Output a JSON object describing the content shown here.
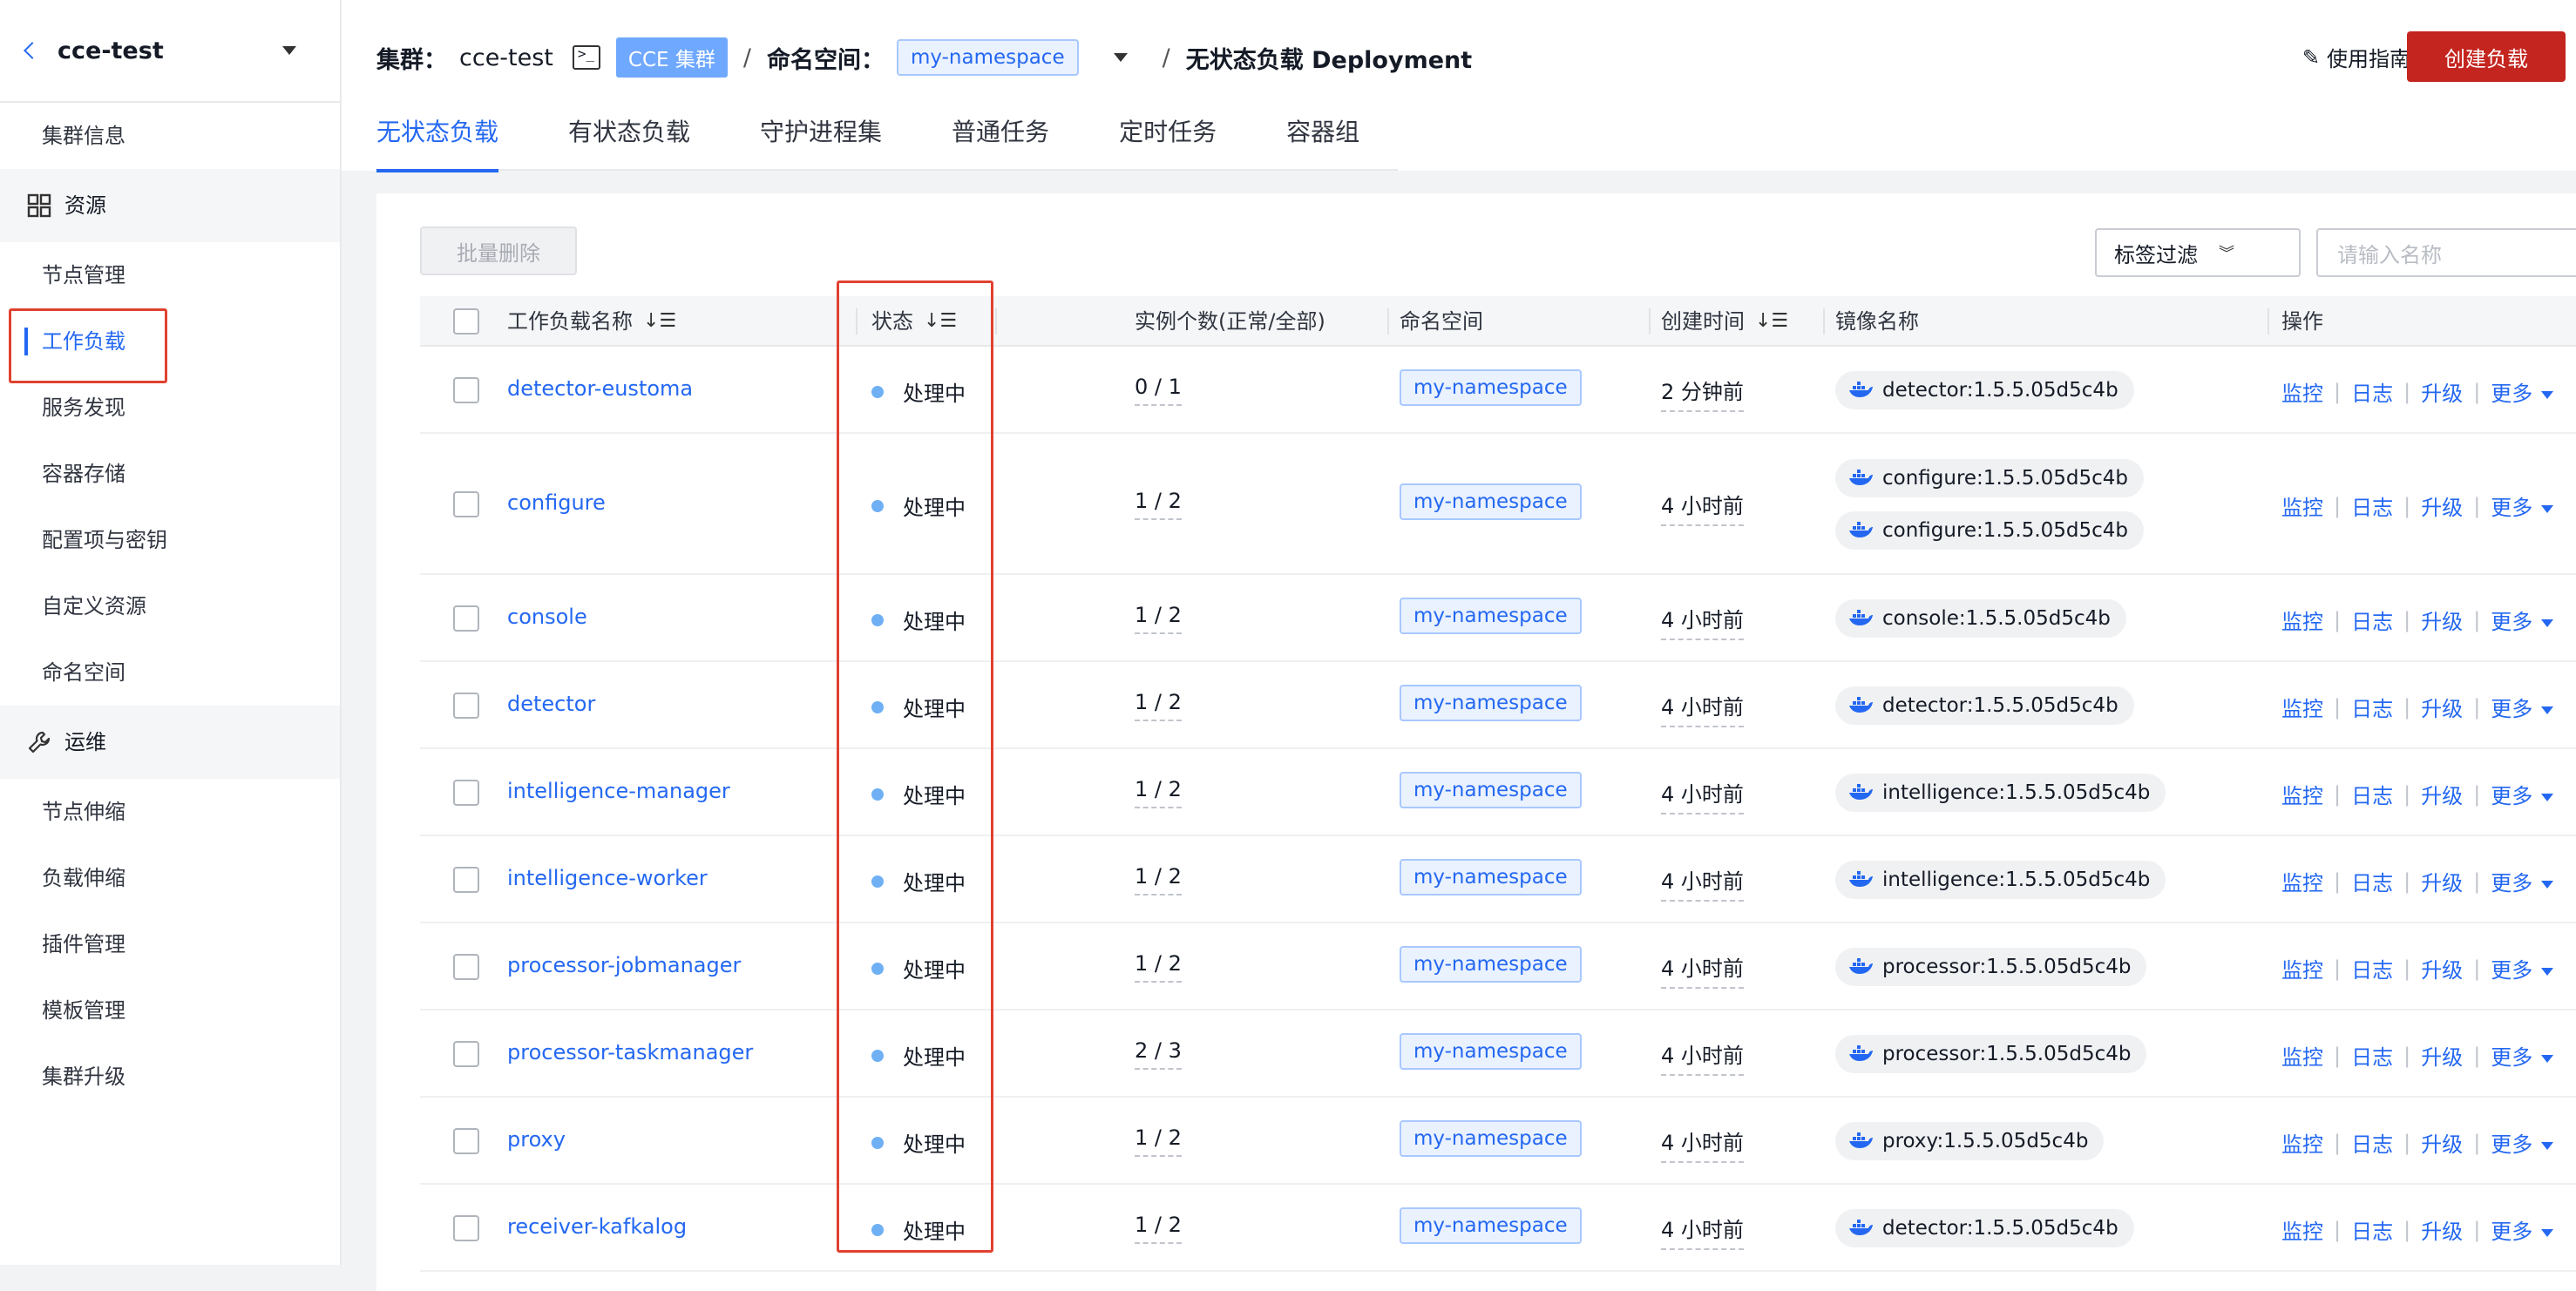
{
  "sidebar": {
    "cluster_name": "cce-test",
    "items": [
      {
        "label": "集群信息",
        "type": "item"
      },
      {
        "label": "资源",
        "type": "group",
        "icon": "grid-icon"
      },
      {
        "label": "节点管理",
        "type": "item"
      },
      {
        "label": "工作负载",
        "type": "item",
        "active": true
      },
      {
        "label": "服务发现",
        "type": "item"
      },
      {
        "label": "容器存储",
        "type": "item"
      },
      {
        "label": "配置项与密钥",
        "type": "item"
      },
      {
        "label": "自定义资源",
        "type": "item"
      },
      {
        "label": "命名空间",
        "type": "item"
      },
      {
        "label": "运维",
        "type": "group",
        "icon": "wrench-icon"
      },
      {
        "label": "节点伸缩",
        "type": "item"
      },
      {
        "label": "负载伸缩",
        "type": "item"
      },
      {
        "label": "插件管理",
        "type": "item"
      },
      {
        "label": "模板管理",
        "type": "item"
      },
      {
        "label": "集群升级",
        "type": "item"
      }
    ]
  },
  "header": {
    "cluster_label": "集群：",
    "cluster_value": "cce-test",
    "cce_tag": "CCE 集群",
    "separator": "/",
    "namespace_label": "命名空间：",
    "namespace_value": "my-namespace",
    "page_title": "无状态负载 Deployment",
    "guide": "使用指南",
    "create_button": "创建负载"
  },
  "tabs": [
    "无状态负载",
    "有状态负载",
    "守护进程集",
    "普通任务",
    "定时任务",
    "容器组"
  ],
  "toolbar": {
    "batch_delete": "批量删除",
    "tag_filter": "标签过滤",
    "search_placeholder": "请输入名称"
  },
  "table": {
    "columns": [
      "工作负载名称",
      "状态",
      "实例个数(正常/全部)",
      "命名空间",
      "创建时间",
      "镜像名称",
      "操作"
    ],
    "ops": [
      "监控",
      "日志",
      "升级",
      "更多"
    ],
    "rows": [
      {
        "name": "detector-eustoma",
        "status": "处理中",
        "instances": "0 / 1",
        "namespace": "my-namespace",
        "created": "2 分钟前",
        "images": [
          "detector:1.5.5.05d5c4b"
        ]
      },
      {
        "name": "configure",
        "status": "处理中",
        "instances": "1 / 2",
        "namespace": "my-namespace",
        "created": "4 小时前",
        "images": [
          "configure:1.5.5.05d5c4b",
          "configure:1.5.5.05d5c4b"
        ]
      },
      {
        "name": "console",
        "status": "处理中",
        "instances": "1 / 2",
        "namespace": "my-namespace",
        "created": "4 小时前",
        "images": [
          "console:1.5.5.05d5c4b"
        ]
      },
      {
        "name": "detector",
        "status": "处理中",
        "instances": "1 / 2",
        "namespace": "my-namespace",
        "created": "4 小时前",
        "images": [
          "detector:1.5.5.05d5c4b"
        ]
      },
      {
        "name": "intelligence-manager",
        "status": "处理中",
        "instances": "1 / 2",
        "namespace": "my-namespace",
        "created": "4 小时前",
        "images": [
          "intelligence:1.5.5.05d5c4b"
        ]
      },
      {
        "name": "intelligence-worker",
        "status": "处理中",
        "instances": "1 / 2",
        "namespace": "my-namespace",
        "created": "4 小时前",
        "images": [
          "intelligence:1.5.5.05d5c4b"
        ]
      },
      {
        "name": "processor-jobmanager",
        "status": "处理中",
        "instances": "1 / 2",
        "namespace": "my-namespace",
        "created": "4 小时前",
        "images": [
          "processor:1.5.5.05d5c4b"
        ]
      },
      {
        "name": "processor-taskmanager",
        "status": "处理中",
        "instances": "2 / 3",
        "namespace": "my-namespace",
        "created": "4 小时前",
        "images": [
          "processor:1.5.5.05d5c4b"
        ]
      },
      {
        "name": "proxy",
        "status": "处理中",
        "instances": "1 / 2",
        "namespace": "my-namespace",
        "created": "4 小时前",
        "images": [
          "proxy:1.5.5.05d5c4b"
        ]
      },
      {
        "name": "receiver-kafkalog",
        "status": "处理中",
        "instances": "1 / 2",
        "namespace": "my-namespace",
        "created": "4 小时前",
        "images": [
          "detector:1.5.5.05d5c4b"
        ]
      }
    ]
  },
  "colors": {
    "accent": "#2468f2",
    "danger": "#c4251f",
    "status_dot": "#6fb0f5",
    "highlight": "#e0412f"
  }
}
